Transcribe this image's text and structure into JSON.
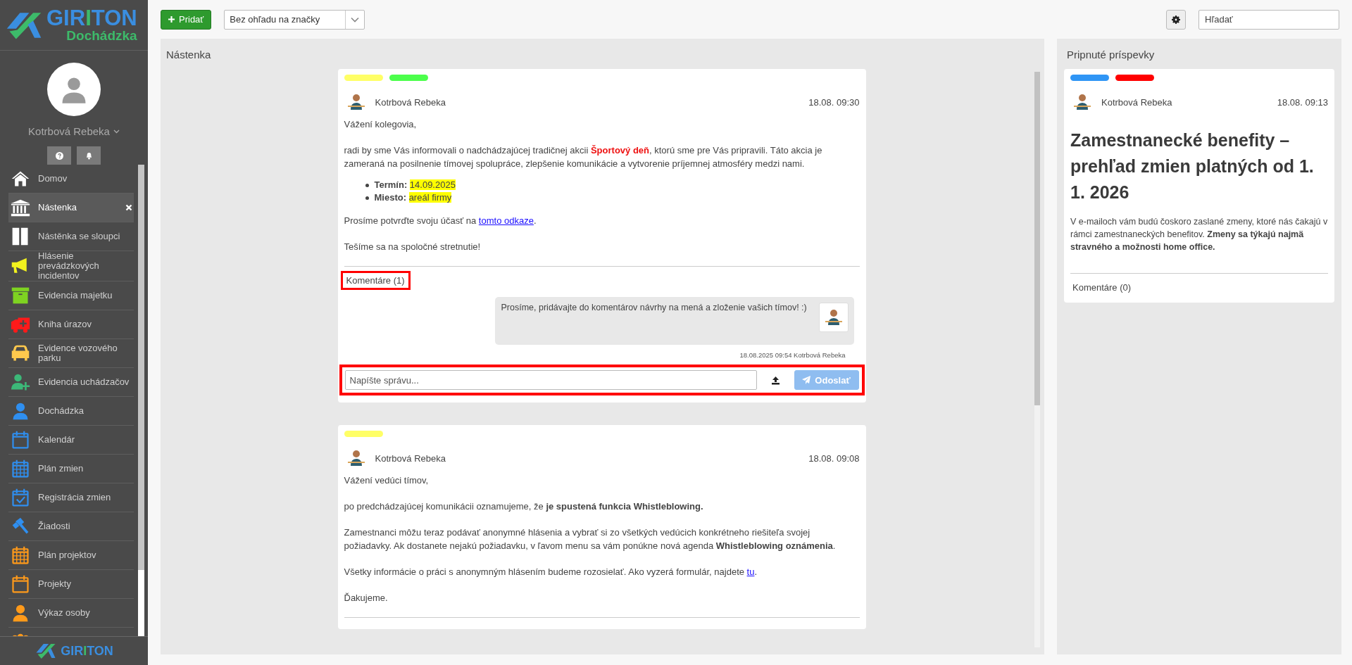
{
  "sidebar": {
    "logo": {
      "wordmark": "GIRITON",
      "product": "Dochádzka"
    },
    "user": {
      "name": "Kotrbová Rebeka"
    },
    "menu": [
      {
        "label": "Domov",
        "kind": "house",
        "color": "#ffffff",
        "selected": false
      },
      {
        "label": "Nástenka",
        "kind": "bank",
        "color": "#ffffff",
        "selected": true
      },
      {
        "label": "Nástěnka se sloupci",
        "kind": "columns",
        "color": "#ffffff",
        "selected": false
      },
      {
        "label": "Hlásenie prevádzkových incidentov",
        "kind": "megaphone",
        "color": "#f2f21e",
        "selected": false
      },
      {
        "label": "Evidencia majetku",
        "kind": "box",
        "color": "#7ed321",
        "selected": false
      },
      {
        "label": "Kniha úrazov",
        "kind": "ambulance",
        "color": "#ff1a1a",
        "selected": false
      },
      {
        "label": "Evidence vozového parku",
        "kind": "car",
        "color": "#ffc94d",
        "selected": false
      },
      {
        "label": "Evidencia uchádzačov",
        "kind": "userplus",
        "color": "#3cb878",
        "selected": false
      },
      {
        "label": "Dochádzka",
        "kind": "user",
        "color": "#2f8ff0",
        "selected": false
      },
      {
        "label": "Kalendár",
        "kind": "calendar",
        "color": "#2f8ff0",
        "selected": false
      },
      {
        "label": "Plán zmien",
        "kind": "grid",
        "color": "#2f8ff0",
        "selected": false
      },
      {
        "label": "Registrácia zmien",
        "kind": "check",
        "color": "#2f8ff0",
        "selected": false
      },
      {
        "label": "Žiadosti",
        "kind": "gavel",
        "color": "#2f8ff0",
        "selected": false
      },
      {
        "label": "Plán projektov",
        "kind": "grid",
        "color": "#ff9a1a",
        "selected": false
      },
      {
        "label": "Projekty",
        "kind": "calendar",
        "color": "#ff9a1a",
        "selected": false
      },
      {
        "label": "Výkaz osoby",
        "kind": "user",
        "color": "#ff9a1a",
        "selected": false
      },
      {
        "kind": "users",
        "color": "#ff9a1a",
        "selected": false
      }
    ],
    "footer_logo": "GIRITON"
  },
  "toolbar": {
    "add_button": "Pridať",
    "tag_filter": "Bez ohľadu na značky",
    "search": {
      "placeholder": "Hľadať"
    }
  },
  "feed": {
    "title": "Nástenka",
    "posts": [
      {
        "tags": [
          {
            "color": "#ffff66"
          },
          {
            "color": "#4cff4c"
          }
        ],
        "author": "Kotrbová Rebeka",
        "time": "18.08. 09:30",
        "body": [
          {
            "kind": "paragraph",
            "segments": [
              {
                "kind": "plain",
                "text": "Vážení kolegovia,"
              }
            ]
          },
          {
            "kind": "paragraph",
            "segments": [
              {
                "kind": "plain",
                "text": "radi by sme Vás informovali o nadchádzajúcej tradičnej akcii "
              },
              {
                "kind": "red",
                "text": "Športový deň"
              },
              {
                "kind": "plain",
                "text": ", ktorú sme pre Vás pripravili. Táto akcia je zameraná na posilnenie tímovej spolupráce, zlepšenie komunikácie a vytvorenie príjemnej atmosféry medzi nami."
              }
            ]
          },
          {
            "kind": "list",
            "items": [
              [
                {
                  "kind": "bold",
                  "text": "Termín: "
                },
                {
                  "kind": "mark",
                  "text": "14.09.2025"
                }
              ],
              [
                {
                  "kind": "bold",
                  "text": "Miesto: "
                },
                {
                  "kind": "mark",
                  "text": "areál firmy"
                }
              ]
            ]
          },
          {
            "kind": "paragraph",
            "segments": [
              {
                "kind": "plain",
                "text": "Prosíme potvrďte svoju účasť na "
              },
              {
                "kind": "link",
                "text": "tomto odkaze"
              },
              {
                "kind": "plain",
                "text": "."
              }
            ]
          },
          {
            "kind": "paragraph",
            "segments": [
              {
                "kind": "plain",
                "text": "Tešíme sa na spoločné stretnutie!"
              }
            ]
          }
        ],
        "comments": {
          "label": "Komentáre (1)",
          "highlighted": true,
          "items": [
            {
              "text": "Prosíme, pridávajte do komentárov návrhy na mená a zloženie vašich tímov! :)",
              "meta": "18.08.2025 09:54 Kotrbová Rebeka"
            }
          ]
        },
        "composer": {
          "placeholder": "Napíšte správu...",
          "send": "Odoslať",
          "send_disabled": true,
          "highlighted": true
        }
      },
      {
        "tags": [
          {
            "color": "#ffff66"
          }
        ],
        "author": "Kotrbová Rebeka",
        "time": "18.08. 09:08",
        "body": [
          {
            "kind": "paragraph",
            "segments": [
              {
                "kind": "plain",
                "text": "Vážení vedúci tímov,"
              }
            ]
          },
          {
            "kind": "paragraph",
            "segments": [
              {
                "kind": "plain",
                "text": "po predchádzajúcej komunikácii oznamujeme, že "
              },
              {
                "kind": "bold",
                "text": "je spustená funkcia Whistleblowing."
              }
            ]
          },
          {
            "kind": "paragraph",
            "segments": [
              {
                "kind": "plain",
                "text": "Zamestnanci môžu teraz podávať anonymné hlásenia a vybrať si zo všetkých vedúcich konkrétneho riešiteľa svojej požiadavky. Ak dostanete nejakú požiadavku, v ľavom menu sa vám ponúkne nová agenda "
              },
              {
                "kind": "bold",
                "text": "Whistleblowing oznámenia"
              },
              {
                "kind": "plain",
                "text": "."
              }
            ]
          },
          {
            "kind": "paragraph",
            "segments": [
              {
                "kind": "plain",
                "text": "Všetky informácie o práci s anonymným hlásením budeme rozosielať. Ako vyzerá formulár, najdete "
              },
              {
                "kind": "link",
                "text": "tu"
              },
              {
                "kind": "plain",
                "text": "."
              }
            ]
          },
          {
            "kind": "paragraph",
            "segments": [
              {
                "kind": "plain",
                "text": "Ďakujeme."
              }
            ]
          }
        ]
      }
    ]
  },
  "pinned": {
    "title": "Pripnuté príspevky",
    "posts": [
      {
        "tags": [
          {
            "color": "#2f95f5"
          },
          {
            "color": "#ff0000"
          }
        ],
        "author": "Kotrbová Rebeka",
        "time": "18.08. 09:13",
        "heading": "Zamestnanecké benefity – prehľad zmien platných od 1. 1. 2026",
        "body": [
          {
            "kind": "paragraph",
            "segments": [
              {
                "kind": "plain",
                "text": "V e-mailoch vám budú čoskoro zaslané zmeny, ktoré nás čakajú v rámci zamestnaneckých benefitov. "
              },
              {
                "kind": "bold",
                "text": "Zmeny sa týkajú najmä stravného a možnosti home office."
              }
            ]
          }
        ],
        "comments": {
          "label": "Komentáre (0)",
          "highlighted": false
        }
      }
    ]
  }
}
